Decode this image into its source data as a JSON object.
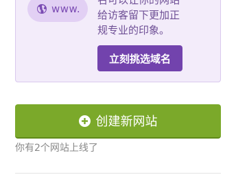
{
  "promo": {
    "domain_pill": {
      "text": "www.",
      "icon": "globe-icon"
    },
    "lines": [
      "名可以让你的网站",
      "给访客留下更加正",
      "规专业的印象。"
    ],
    "button_label": "立刻挑选域名"
  },
  "create_site": {
    "label": "创建新网站",
    "icon": "plus-circle-icon"
  },
  "status_text": "你有2个网站上线了",
  "colors": {
    "promo_bg": "#f3ecfa",
    "promo_text": "#6e4f95",
    "pill_bg": "#e2d0f4",
    "primary_purple": "#7243ad",
    "create_green": "#7ba92a",
    "muted_text": "#888888"
  }
}
